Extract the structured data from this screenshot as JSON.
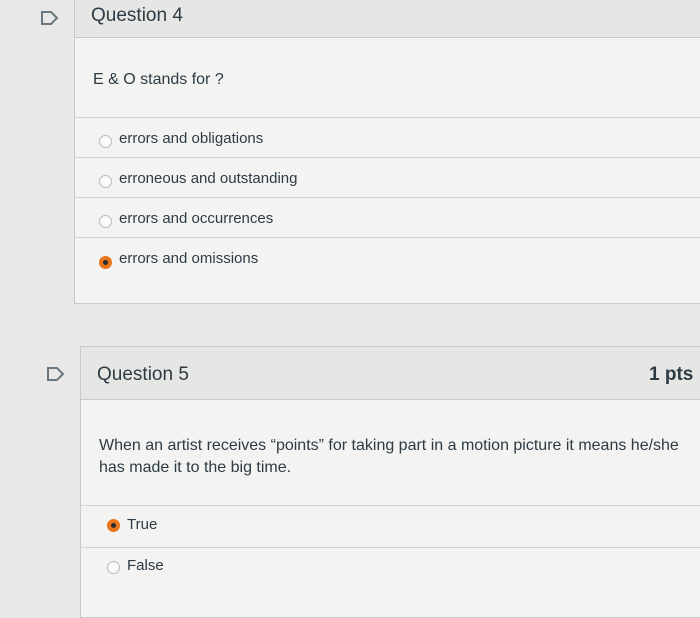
{
  "question4": {
    "title": "Question 4",
    "text": "E & O stands for ?",
    "answers": [
      {
        "label": "errors and obligations",
        "selected": false
      },
      {
        "label": "erroneous and outstanding",
        "selected": false
      },
      {
        "label": "errors and occurrences",
        "selected": false
      },
      {
        "label": "errors and omissions",
        "selected": true
      }
    ]
  },
  "question5": {
    "title": "Question 5",
    "points": "1 pts",
    "text": "When an artist receives “points” for taking part in a motion picture it means he/she has made it to the big time.",
    "answers": [
      {
        "label": "True",
        "selected": true
      },
      {
        "label": "False",
        "selected": false
      }
    ]
  },
  "colors": {
    "accent": "#e8751a",
    "flag": "#6b7780"
  }
}
